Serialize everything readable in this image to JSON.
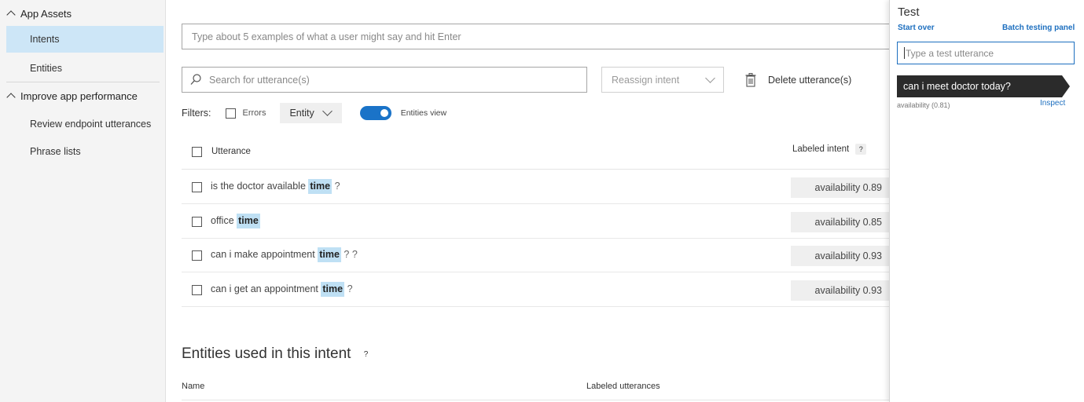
{
  "sidebar": {
    "sections": [
      {
        "label": "App Assets"
      },
      {
        "label": "Improve app performance"
      }
    ],
    "items": [
      {
        "label": "Intents"
      },
      {
        "label": "Entities"
      },
      {
        "label": "Review endpoint utterances"
      },
      {
        "label": "Phrase lists"
      }
    ]
  },
  "main": {
    "utterance_placeholder": "Type about 5 examples of what a user might say and hit Enter",
    "search_placeholder": "Search for utterance(s)",
    "reassign_label": "Reassign intent",
    "delete_label": "Delete utterance(s)",
    "filters": {
      "label": "Filters:",
      "errors_label": "Errors",
      "entity_label": "Entity",
      "entities_view_label": "Entities view",
      "entities_view_on": true
    },
    "table": {
      "col_utterance": "Utterance",
      "col_intent": "Labeled intent",
      "help": "?",
      "rows": [
        {
          "before": "is the doctor available",
          "entity": "time",
          "after": "?",
          "intent": "availability 0.89"
        },
        {
          "before": "office",
          "entity": "time",
          "after": "",
          "intent": "availability 0.85"
        },
        {
          "before": "can i make appointment",
          "entity": "time",
          "after": "? ?",
          "intent": "availability 0.93"
        },
        {
          "before": "can i get an appointment",
          "entity": "time",
          "after": "?",
          "intent": "availability 0.93"
        }
      ]
    },
    "entities_section": {
      "title": "Entities used in this intent",
      "help": "?",
      "col_name": "Name",
      "col_labeled": "Labeled utterances"
    }
  },
  "test_panel": {
    "title": "Test",
    "start_over": "Start over",
    "batch_testing": "Batch testing panel",
    "input_placeholder": "Type a test utterance",
    "last_utterance": "can i meet doctor today?",
    "result": "availability (0.81)",
    "inspect": "Inspect"
  },
  "colors": {
    "accent": "#1d6fbf",
    "toggle_on": "#1a73c8",
    "entity_highlight": "#bfe0f4",
    "active_nav": "#cde6f7"
  }
}
